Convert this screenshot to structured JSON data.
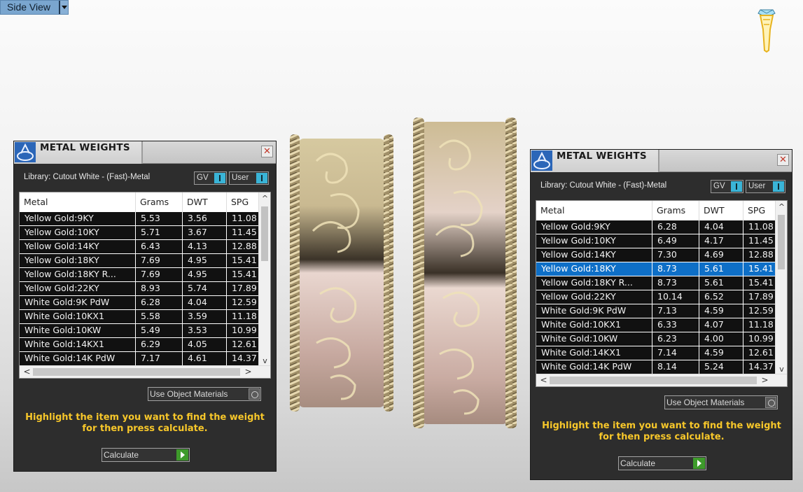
{
  "viewport": {
    "view_label": "Side View"
  },
  "colors": {
    "panel_bg": "#2d2d2d",
    "hint_text": "#f7c72a",
    "selected_row": "#0e6fc7",
    "toggle_accent": "#3ab4d7",
    "calculate_accent": "#3e9b2b",
    "ring_metal": "#c9b98a"
  },
  "icons": [
    "chevron-down-icon",
    "gem-setting-icon",
    "metal-weights-icon",
    "close-icon",
    "scroll-up-icon",
    "scroll-down-icon",
    "scroll-left-icon",
    "scroll-right-icon",
    "radio-icon",
    "play-icon"
  ],
  "panels": [
    {
      "title": "METAL WEIGHTS",
      "close_glyph": "✕",
      "library_text": "Library: Cutout White - (Fast)-Metal",
      "gv_label": "GV",
      "user_label": "User",
      "columns": [
        "Metal",
        "Grams",
        "DWT",
        "SPG"
      ],
      "selected_index": -1,
      "rows": [
        [
          "Yellow Gold:9KY",
          "5.53",
          "3.56",
          "11.08"
        ],
        [
          "Yellow Gold:10KY",
          "5.71",
          "3.67",
          "11.45"
        ],
        [
          "Yellow Gold:14KY",
          "6.43",
          "4.13",
          "12.88"
        ],
        [
          "Yellow Gold:18KY",
          "7.69",
          "4.95",
          "15.41"
        ],
        [
          "Yellow Gold:18KY R...",
          "7.69",
          "4.95",
          "15.41"
        ],
        [
          "Yellow Gold:22KY",
          "8.93",
          "5.74",
          "17.89"
        ],
        [
          "White Gold:9K PdW",
          "6.28",
          "4.04",
          "12.59"
        ],
        [
          "White Gold:10KX1",
          "5.58",
          "3.59",
          "11.18"
        ],
        [
          "White Gold:10KW",
          "5.49",
          "3.53",
          "10.99"
        ],
        [
          "White Gold:14KX1",
          "6.29",
          "4.05",
          "12.61"
        ],
        [
          "White Gold:14K PdW",
          "7.17",
          "4.61",
          "14.37"
        ]
      ],
      "use_object_materials": "Use Object Materials",
      "hint_line1": "Highlight the item you want to find the weight",
      "hint_line2": "for then press calculate.",
      "calculate_label": "Calculate"
    },
    {
      "title": "METAL WEIGHTS",
      "close_glyph": "✕",
      "library_text": "Library: Cutout White - (Fast)-Metal",
      "gv_label": "GV",
      "user_label": "User",
      "columns": [
        "Metal",
        "Grams",
        "DWT",
        "SPG"
      ],
      "selected_index": 3,
      "rows": [
        [
          "Yellow Gold:9KY",
          "6.28",
          "4.04",
          "11.08"
        ],
        [
          "Yellow Gold:10KY",
          "6.49",
          "4.17",
          "11.45"
        ],
        [
          "Yellow Gold:14KY",
          "7.30",
          "4.69",
          "12.88"
        ],
        [
          "Yellow Gold:18KY",
          "8.73",
          "5.61",
          "15.41"
        ],
        [
          "Yellow Gold:18KY R...",
          "8.73",
          "5.61",
          "15.41"
        ],
        [
          "Yellow Gold:22KY",
          "10.14",
          "6.52",
          "17.89"
        ],
        [
          "White Gold:9K PdW",
          "7.13",
          "4.59",
          "12.59"
        ],
        [
          "White Gold:10KX1",
          "6.33",
          "4.07",
          "11.18"
        ],
        [
          "White Gold:10KW",
          "6.23",
          "4.00",
          "10.99"
        ],
        [
          "White Gold:14KX1",
          "7.14",
          "4.59",
          "12.61"
        ],
        [
          "White Gold:14K PdW",
          "8.14",
          "5.24",
          "14.37"
        ]
      ],
      "use_object_materials": "Use Object Materials",
      "hint_line1": "Highlight the item you want to find the weight",
      "hint_line2": "for then press calculate.",
      "calculate_label": "Calculate"
    }
  ]
}
